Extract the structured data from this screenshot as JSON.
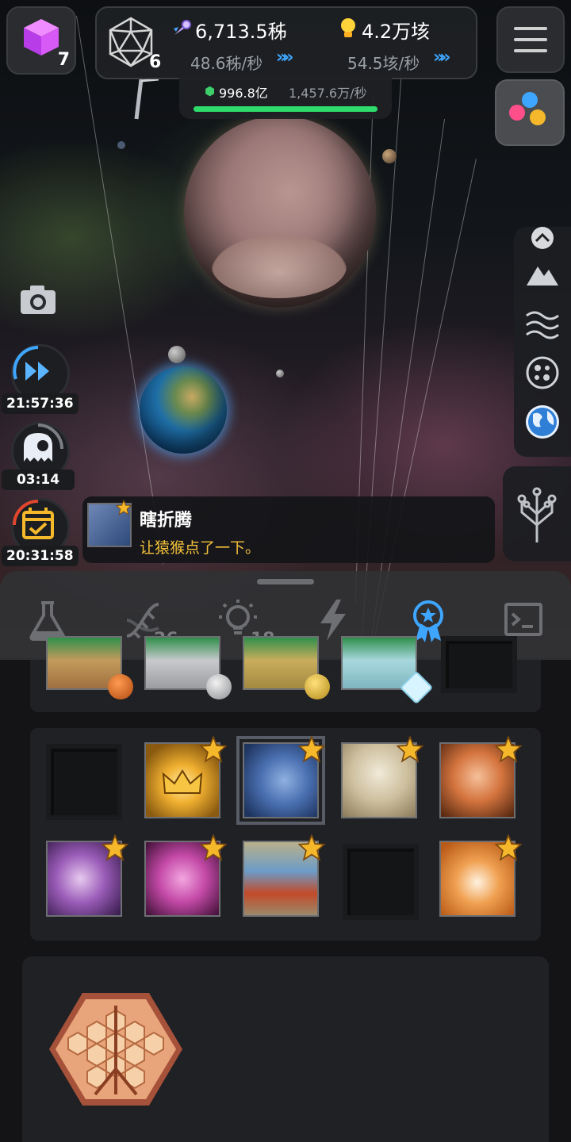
{
  "top_bar": {
    "cube_count": "7",
    "dice_count": "6",
    "resource1_value": "6,713.5秭",
    "resource1_rate": "48.6秭/秒",
    "resource2_value": "4.2万垓",
    "resource2_rate": "54.5垓/秒",
    "gem_value": "996.8亿",
    "gem_rate": "1,457.6万/秒",
    "progress": 1.0
  },
  "left_timers": [
    {
      "label": "21:57:36",
      "icon": "fast-forward-icon"
    },
    {
      "label": "03:14",
      "icon": "ghost-icon"
    },
    {
      "label": "20:31:58",
      "icon": "calendar-check-icon"
    }
  ],
  "toast": {
    "title": "瞎折腾",
    "message": "让猿猴点了一下。"
  },
  "tabs": [
    {
      "icon": "flask-icon",
      "count": ""
    },
    {
      "icon": "dna-icon",
      "count": "26"
    },
    {
      "icon": "lightbulb-icon",
      "count": "18"
    },
    {
      "icon": "lightning-icon",
      "count": ""
    },
    {
      "icon": "award-icon",
      "count": ""
    },
    {
      "icon": "terminal-icon",
      "count": ""
    }
  ],
  "colors": {
    "accent_blue": "#3ea6ff",
    "gem_green": "#2fdc6b",
    "toast_text": "#f3c23a",
    "star_gold": "#f5b82a"
  }
}
